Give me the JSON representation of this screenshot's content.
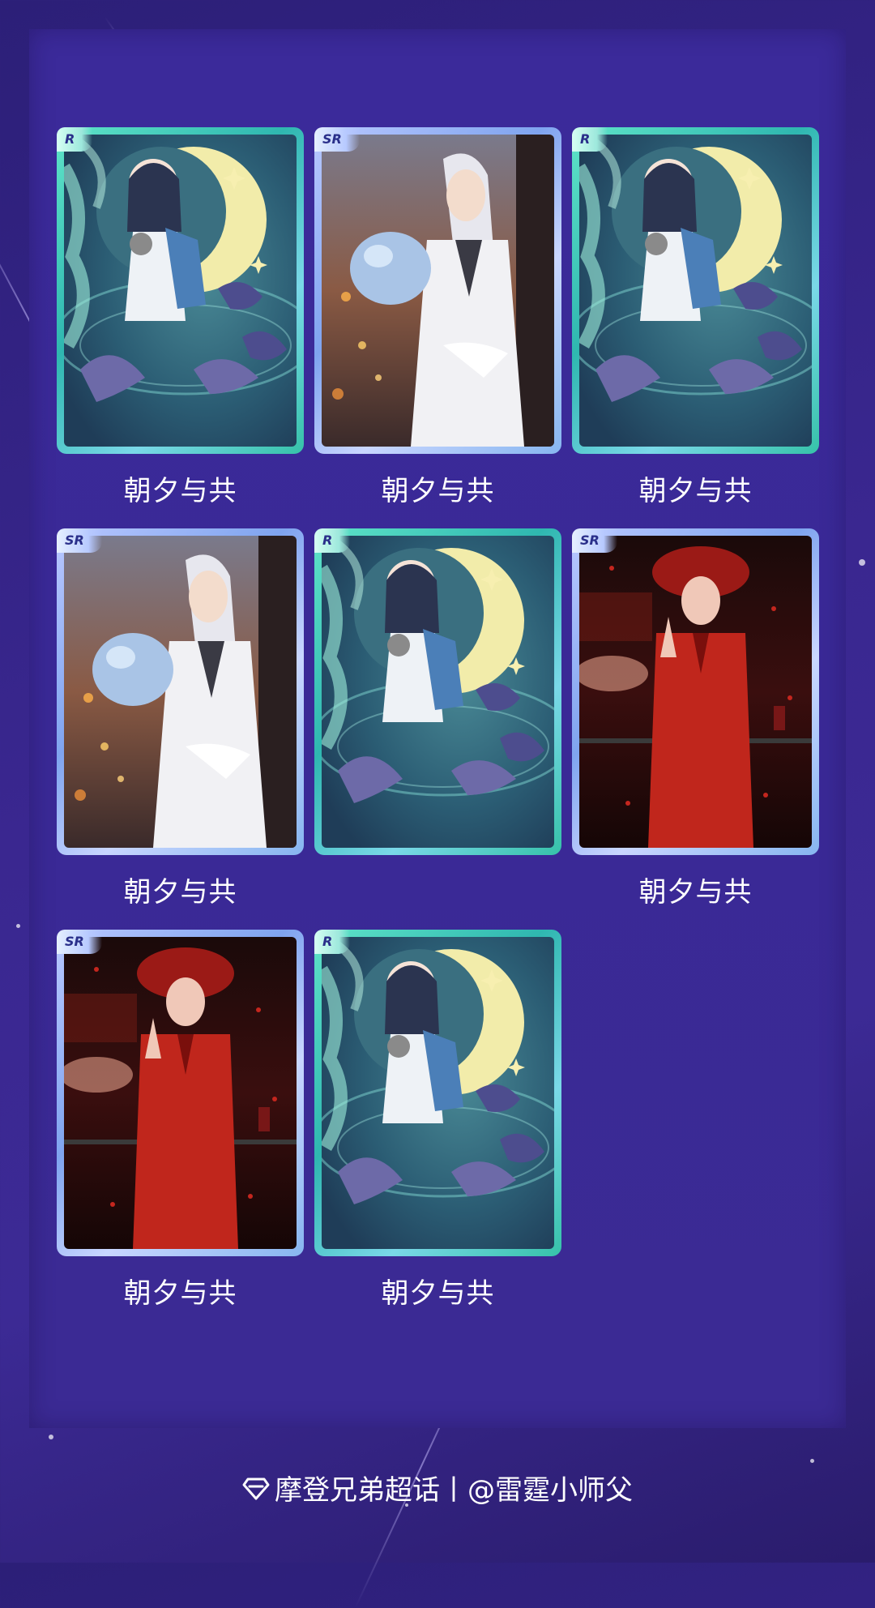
{
  "cards": [
    {
      "rarity": "R",
      "theme": "moon",
      "caption": "朝夕与共"
    },
    {
      "rarity": "SR",
      "theme": "white",
      "caption": "朝夕与共"
    },
    {
      "rarity": "R",
      "theme": "moon",
      "caption": "朝夕与共"
    },
    {
      "rarity": "SR",
      "theme": "white",
      "caption": "朝夕与共"
    },
    {
      "rarity": "R",
      "theme": "moon",
      "caption": ""
    },
    {
      "rarity": "SR",
      "theme": "red",
      "caption": "朝夕与共"
    },
    {
      "rarity": "SR",
      "theme": "red",
      "caption": "朝夕与共"
    },
    {
      "rarity": "R",
      "theme": "moon",
      "caption": "朝夕与共"
    }
  ],
  "footer": {
    "icon": "diamond-icon",
    "text": "摩登兄弟超话丨@雷霆小师父"
  },
  "colors": {
    "background": "#33248a",
    "r_frame": "#36c2a9",
    "sr_frame": "#8fb0f2"
  }
}
